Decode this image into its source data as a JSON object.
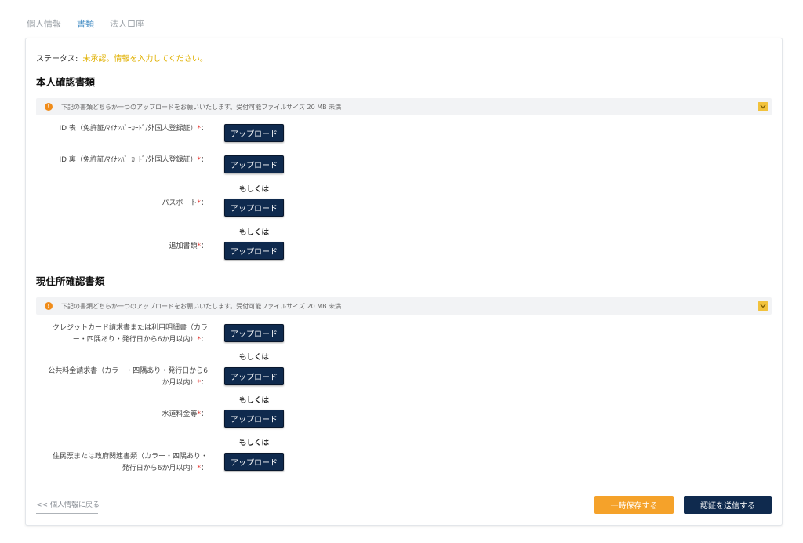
{
  "tabs": [
    {
      "label": "個人情報"
    },
    {
      "label": "書類"
    },
    {
      "label": "法人口座"
    }
  ],
  "status": {
    "label": "ステータス:",
    "value": "未承認。情報を入力してください。",
    "value_color": "#e0b000"
  },
  "identity_section": {
    "title": "本人確認書類",
    "notice": "下記の書類どちらか一つのアップロードをお願いいたします。受付可能ファイルサイズ 20 MB 未満",
    "rows": [
      {
        "label": "ID 表（免許証/ﾏｲﾅﾝﾊﾞｰｶｰﾄﾞ/外国人登録証）",
        "required": "*",
        "colon": "："
      },
      {
        "label": "ID 裏（免許証/ﾏｲﾅﾝﾊﾞｰｶｰﾄﾞ/外国人登録証）",
        "required": "*",
        "colon": "："
      },
      {
        "label": "パスポート",
        "required": "*",
        "colon": "："
      },
      {
        "label": "追加書類",
        "required": "*",
        "colon": "："
      }
    ]
  },
  "address_section": {
    "title": "現住所確認書類",
    "notice": "下記の書類どちらか一つのアップロードをお願いいたします。受付可能ファイルサイズ 20 MB 未満",
    "rows": [
      {
        "label_line1": "クレジットカード請求書または利用明細書（カラ",
        "label_line2": "ー・四隅あり・発行日から6か月以内）",
        "required": "*",
        "colon": "："
      },
      {
        "label_line1": "公共料金請求書（カラー・四隅あり・発行日から6",
        "label_line2": "か月以内）",
        "required": "*",
        "colon": "："
      },
      {
        "label": "水道料金等",
        "required": "*",
        "colon": "："
      },
      {
        "label_line1": "住民票または政府関連書類（カラー・四隅あり・",
        "label_line2": "発行日から6か月以内）",
        "required": "*",
        "colon": "："
      }
    ]
  },
  "upload_label": "アップロード",
  "or_label": "もしくは",
  "back_link": "<< 個人情報に戻る",
  "save_button": "一時保存する",
  "submit_button": "認証を送信する",
  "colors": {
    "primary": "#0f2a4e",
    "accent_orange": "#f5a22a",
    "required": "#e53935",
    "info": "#f08c1a",
    "chevron": "#f2c23c",
    "tab_active": "#4a90c6"
  },
  "icons": {
    "notice_icon": "info-icon",
    "collapse_icon": "chevron-down-icon"
  }
}
